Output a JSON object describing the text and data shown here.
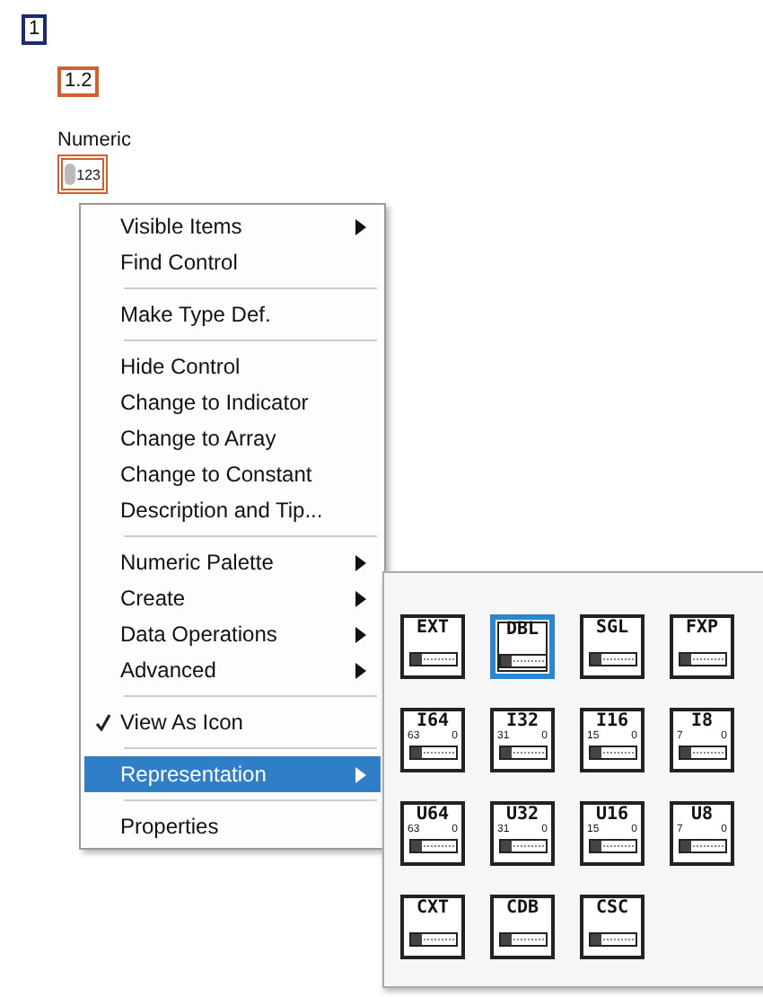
{
  "top_controls": [
    {
      "text": "1",
      "color": "#1c2a70"
    },
    {
      "text": "1.2",
      "color": "#d2602c"
    }
  ],
  "numeric_control": {
    "label": "Numeric",
    "text": "123"
  },
  "context_menu": {
    "groups": [
      {
        "items": [
          {
            "label": "Visible Items",
            "submenu": true,
            "checked": false,
            "selected": false
          },
          {
            "label": "Find Control",
            "submenu": false,
            "checked": false,
            "selected": false
          }
        ]
      },
      {
        "items": [
          {
            "label": "Make Type Def.",
            "submenu": false,
            "checked": false,
            "selected": false
          }
        ]
      },
      {
        "items": [
          {
            "label": "Hide Control",
            "submenu": false,
            "checked": false,
            "selected": false
          },
          {
            "label": "Change to Indicator",
            "submenu": false,
            "checked": false,
            "selected": false
          },
          {
            "label": "Change to Array",
            "submenu": false,
            "checked": false,
            "selected": false
          },
          {
            "label": "Change to Constant",
            "submenu": false,
            "checked": false,
            "selected": false
          },
          {
            "label": "Description and Tip...",
            "submenu": false,
            "checked": false,
            "selected": false
          }
        ]
      },
      {
        "items": [
          {
            "label": "Numeric Palette",
            "submenu": true,
            "checked": false,
            "selected": false
          },
          {
            "label": "Create",
            "submenu": true,
            "checked": false,
            "selected": false
          },
          {
            "label": "Data Operations",
            "submenu": true,
            "checked": false,
            "selected": false
          },
          {
            "label": "Advanced",
            "submenu": true,
            "checked": false,
            "selected": false
          }
        ]
      },
      {
        "items": [
          {
            "label": "View As Icon",
            "submenu": false,
            "checked": true,
            "selected": false
          }
        ]
      },
      {
        "items": [
          {
            "label": "Representation",
            "submenu": true,
            "checked": false,
            "selected": true
          }
        ]
      },
      {
        "items": [
          {
            "label": "Properties",
            "submenu": false,
            "checked": false,
            "selected": false
          }
        ]
      }
    ]
  },
  "representation_palette": {
    "tiles": [
      {
        "label": "EXT",
        "selected": false
      },
      {
        "label": "DBL",
        "selected": true
      },
      {
        "label": "SGL",
        "selected": false
      },
      {
        "label": "FXP",
        "selected": false
      },
      {
        "label": "I64",
        "selected": false,
        "bit_high": "63",
        "bit_low": "0"
      },
      {
        "label": "I32",
        "selected": false,
        "bit_high": "31",
        "bit_low": "0"
      },
      {
        "label": "I16",
        "selected": false,
        "bit_high": "15",
        "bit_low": "0"
      },
      {
        "label": "I8",
        "selected": false,
        "bit_high": "7",
        "bit_low": "0"
      },
      {
        "label": "U64",
        "selected": false,
        "bit_high": "63",
        "bit_low": "0"
      },
      {
        "label": "U32",
        "selected": false,
        "bit_high": "31",
        "bit_low": "0"
      },
      {
        "label": "U16",
        "selected": false,
        "bit_high": "15",
        "bit_low": "0"
      },
      {
        "label": "U8",
        "selected": false,
        "bit_high": "7",
        "bit_low": "0"
      },
      {
        "label": "CXT",
        "selected": false
      },
      {
        "label": "CDB",
        "selected": false
      },
      {
        "label": "CSC",
        "selected": false
      }
    ]
  }
}
